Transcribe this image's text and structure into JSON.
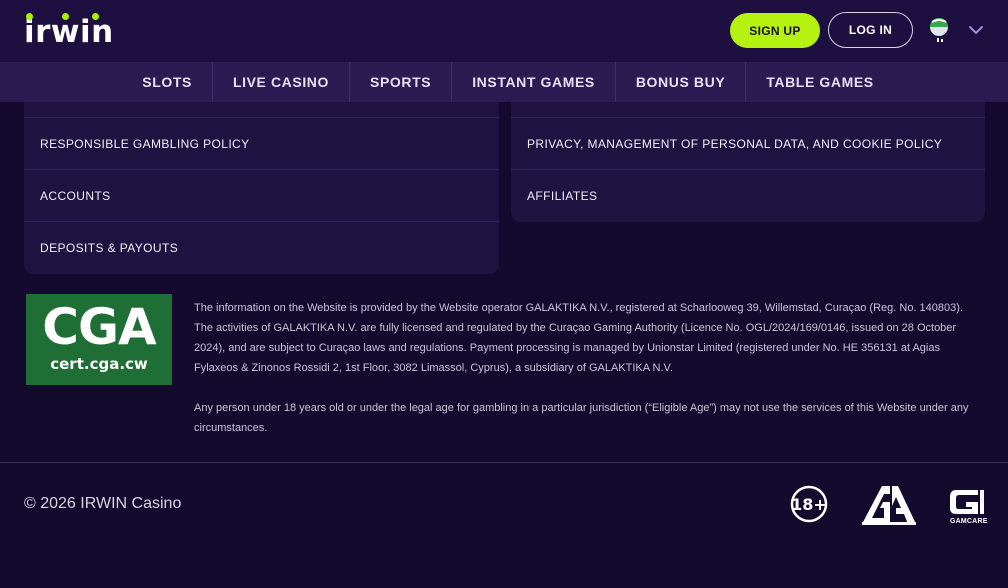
{
  "header": {
    "logo": "irwin",
    "signup_label": "SIGN UP",
    "login_label": "LOG IN",
    "language_icon": "globe-flag-icon",
    "menu_icon": "chevron-down-icon"
  },
  "nav": {
    "items": [
      {
        "label": "SLOTS"
      },
      {
        "label": "LIVE CASINO"
      },
      {
        "label": "SPORTS"
      },
      {
        "label": "INSTANT GAMES"
      },
      {
        "label": "BONUS BUY"
      },
      {
        "label": "TABLE GAMES"
      }
    ]
  },
  "links_left": [
    {
      "label": "RESPONSIBLE GAMBLING POLICY"
    },
    {
      "label": "ACCOUNTS"
    },
    {
      "label": "DEPOSITS & PAYOUTS"
    }
  ],
  "links_right": [
    {
      "label": "PRIVACY, MANAGEMENT OF PERSONAL DATA, AND COOKIE POLICY"
    },
    {
      "label": "AFFILIATES"
    }
  ],
  "cga": {
    "main": "CGA",
    "sub": "cert.cga.cw"
  },
  "legal": {
    "paragraph1": "The information on the Website is provided by the Website operator GALAKTIKA N.V., registered at Scharlooweg 39, Willemstad, Curaçao (Reg. No. 140803). The activities of GALAKTIKA N.V. are fully licensed and regulated by the Curaçao Gaming Authority (Licence No. OGL/2024/169/0146, issued on 28 October 2024), and are subject to Curaçao laws and regulations. Payment processing is managed by Unionstar Limited (registered under No. HE 356131 at Agias Fylaxeos & Zinonos Rossidi 2, 1st Floor, 3082 Limassol, Cyprus), a subsidiary of GALAKTIKA N.V.",
    "paragraph2": "Any person under 18 years old or under the legal age for gambling in a particular jurisdiction (“Eligible Age”) may not use the services of this Website under any circumstances."
  },
  "footer": {
    "copyright": "© 2026 IRWIN Casino",
    "age_badge": "18+",
    "gamcare_label": "GAMCARE"
  },
  "colors": {
    "background": "#140a2e",
    "header": "#1d1040",
    "nav": "#2a1b52",
    "accent": "#b5f20f",
    "panel": "#1f1342",
    "cga_green": "#1f6e35"
  }
}
